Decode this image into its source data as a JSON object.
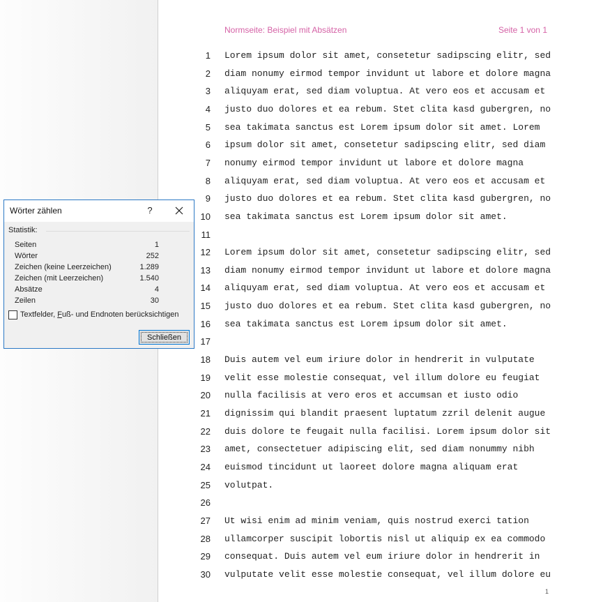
{
  "document": {
    "header_left": "Normseite: Beispiel mit Absätzen",
    "header_right": "Seite 1 von 1",
    "footer_page_number": "1",
    "lines": [
      {
        "num": "1",
        "text": "Lorem ipsum dolor sit amet, consetetur sadipscing elitr, sed"
      },
      {
        "num": "2",
        "text": "diam nonumy eirmod tempor invidunt ut labore et dolore magna"
      },
      {
        "num": "3",
        "text": "aliquyam erat, sed diam voluptua. At vero eos et accusam et"
      },
      {
        "num": "4",
        "text": "justo duo dolores et ea rebum. Stet clita kasd gubergren, no"
      },
      {
        "num": "5",
        "text": "sea takimata sanctus est Lorem ipsum dolor sit amet. Lorem"
      },
      {
        "num": "6",
        "text": "ipsum dolor sit amet, consetetur sadipscing elitr, sed diam"
      },
      {
        "num": "7",
        "text": "nonumy eirmod tempor invidunt ut labore et dolore magna"
      },
      {
        "num": "8",
        "text": "aliquyam erat, sed diam voluptua. At vero eos et accusam et"
      },
      {
        "num": "9",
        "text": "justo duo dolores et ea rebum. Stet clita kasd gubergren, no"
      },
      {
        "num": "10",
        "text": "sea takimata sanctus est Lorem ipsum dolor sit amet."
      },
      {
        "num": "11",
        "text": ""
      },
      {
        "num": "12",
        "text": "Lorem ipsum dolor sit amet, consetetur sadipscing elitr, sed"
      },
      {
        "num": "13",
        "text": "diam nonumy eirmod tempor invidunt ut labore et dolore magna"
      },
      {
        "num": "14",
        "text": "aliquyam erat, sed diam voluptua. At vero eos et accusam et"
      },
      {
        "num": "15",
        "text": "justo duo dolores et ea rebum. Stet clita kasd gubergren, no"
      },
      {
        "num": "16",
        "text": "sea takimata sanctus est Lorem ipsum dolor sit amet."
      },
      {
        "num": "17",
        "text": ""
      },
      {
        "num": "18",
        "text": "Duis autem vel eum iriure dolor in hendrerit in vulputate"
      },
      {
        "num": "19",
        "text": "velit esse molestie consequat, vel illum dolore eu feugiat"
      },
      {
        "num": "20",
        "text": "nulla facilisis at vero eros et accumsan et iusto odio"
      },
      {
        "num": "21",
        "text": "dignissim qui blandit praesent luptatum zzril delenit augue"
      },
      {
        "num": "22",
        "text": "duis dolore te feugait nulla facilisi. Lorem ipsum dolor sit"
      },
      {
        "num": "23",
        "text": "amet, consectetuer adipiscing elit, sed diam nonummy nibh"
      },
      {
        "num": "24",
        "text": "euismod tincidunt ut laoreet dolore magna aliquam erat"
      },
      {
        "num": "25",
        "text": "volutpat."
      },
      {
        "num": "26",
        "text": ""
      },
      {
        "num": "27",
        "text": "Ut wisi enim ad minim veniam, quis nostrud exerci tation"
      },
      {
        "num": "28",
        "text": "ullamcorper suscipit lobortis nisl ut aliquip ex ea commodo"
      },
      {
        "num": "29",
        "text": "consequat. Duis autem vel eum iriure dolor in hendrerit in"
      },
      {
        "num": "30",
        "text": "vulputate velit esse molestie consequat, vel illum dolore eu"
      }
    ]
  },
  "dialog": {
    "title": "Wörter zählen",
    "help_label": "?",
    "close_icon": "close-icon",
    "section_label": "Statistik:",
    "stats": [
      {
        "label": "Seiten",
        "value": "1"
      },
      {
        "label": "Wörter",
        "value": "252"
      },
      {
        "label": "Zeichen (keine Leerzeichen)",
        "value": "1.289"
      },
      {
        "label": "Zeichen (mit Leerzeichen)",
        "value": "1.540"
      },
      {
        "label": "Absätze",
        "value": "4"
      },
      {
        "label": "Zeilen",
        "value": "30"
      }
    ],
    "checkbox_before": "Textfelder, ",
    "checkbox_underlined": "F",
    "checkbox_after": "uß- und Endnoten berücksichtigen",
    "checkbox_checked": false,
    "button_label": "Schließen",
    "accent_color": "#2b78c5"
  },
  "colors": {
    "header_text": "#d562a6",
    "spellcheck_underline": "#e0241b"
  }
}
